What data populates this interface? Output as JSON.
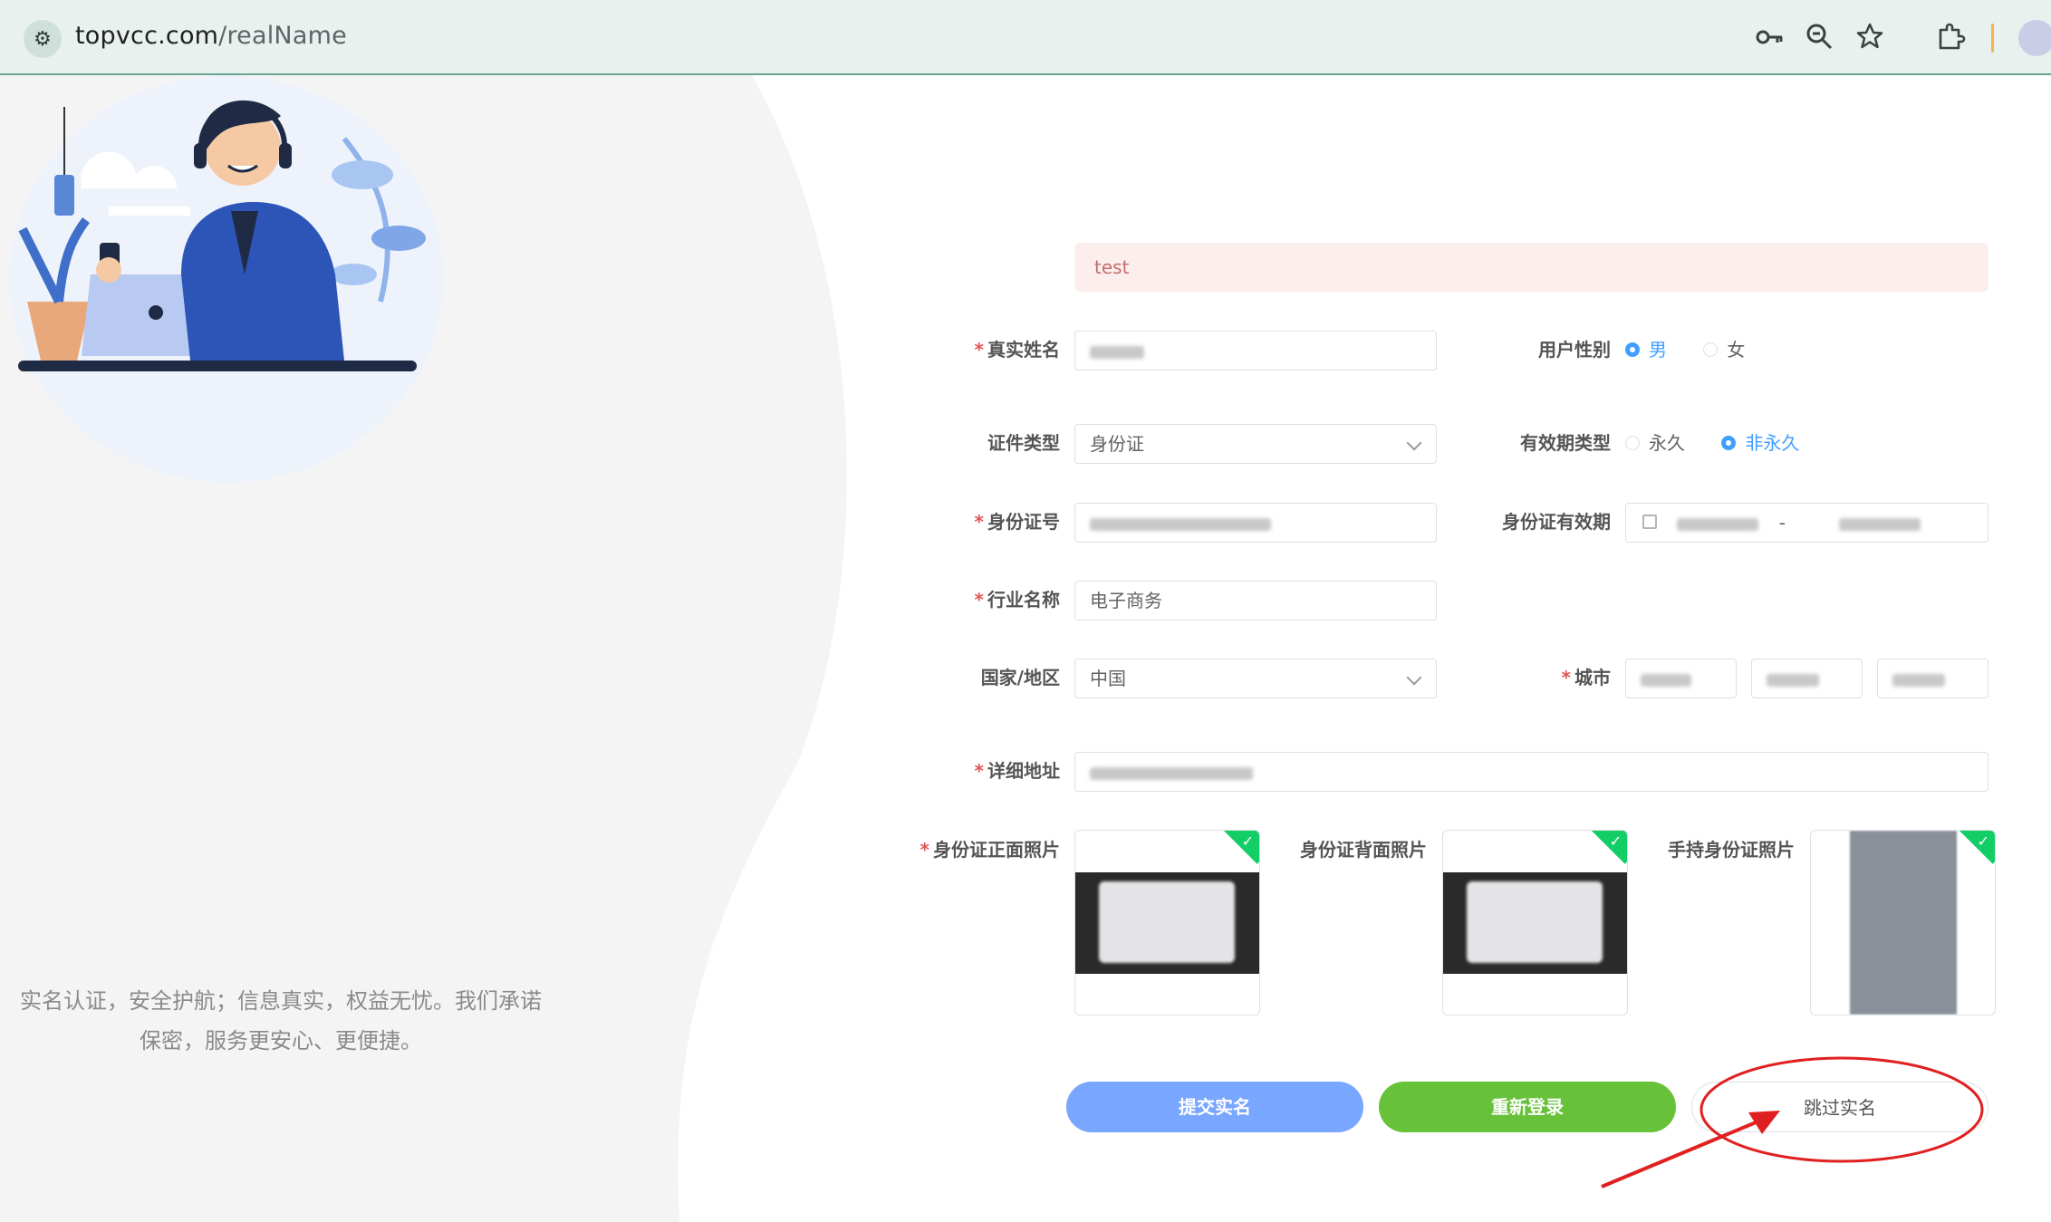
{
  "browser": {
    "url_host": "topvcc.com",
    "url_path": "/realName",
    "icons": [
      "site-settings-icon",
      "key-icon",
      "zoom-icon",
      "star-icon",
      "extensions-icon"
    ]
  },
  "left": {
    "slogan_line1": "实名认证，安全护航；信息真实，权益无忧。我们承诺",
    "slogan_line2": "保密，服务更安心、更便捷。"
  },
  "alert": {
    "text": "test"
  },
  "form": {
    "real_name_label": "真实姓名",
    "gender_label": "用户性别",
    "gender_male": "男",
    "gender_female": "女",
    "gender_selected": "男",
    "id_type_label": "证件类型",
    "id_type_value": "身份证",
    "validity_type_label": "有效期类型",
    "validity_permanent": "永久",
    "validity_non_permanent": "非永久",
    "validity_selected": "非永久",
    "id_number_label": "身份证号",
    "id_validity_label": "身份证有效期",
    "date_separator": "-",
    "industry_label": "行业名称",
    "industry_value": "电子商务",
    "country_label": "国家/地区",
    "country_value": "中国",
    "city_label": "城市",
    "address_label": "详细地址",
    "id_front_label": "身份证正面照片",
    "id_back_label": "身份证背面照片",
    "handheld_label": "手持身份证照片"
  },
  "buttons": {
    "submit": "提交实名",
    "relogin": "重新登录",
    "skip": "跳过实名"
  },
  "colors": {
    "primary": "#409eff",
    "submit_bg": "#79a6ff",
    "success": "#67c23a",
    "danger_annotation": "#e02020"
  }
}
